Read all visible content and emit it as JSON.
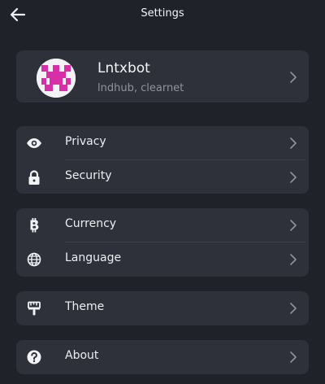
{
  "header": {
    "title": "Settings"
  },
  "profile": {
    "name": "Lntxbot",
    "subtitle": "lndhub, clearnet"
  },
  "groups": [
    {
      "items": [
        {
          "label": "Privacy",
          "icon": "eye-icon"
        },
        {
          "label": "Security",
          "icon": "lock-icon"
        }
      ]
    },
    {
      "items": [
        {
          "label": "Currency",
          "icon": "bitcoin-icon"
        },
        {
          "label": "Language",
          "icon": "globe-icon"
        }
      ]
    },
    {
      "items": [
        {
          "label": "Theme",
          "icon": "paint-roller-icon"
        }
      ]
    },
    {
      "items": [
        {
          "label": "About",
          "icon": "help-circle-icon"
        }
      ]
    }
  ],
  "colors": {
    "background": "#202229",
    "card": "#2e3139",
    "avatar_accent": "#d72fa6"
  }
}
